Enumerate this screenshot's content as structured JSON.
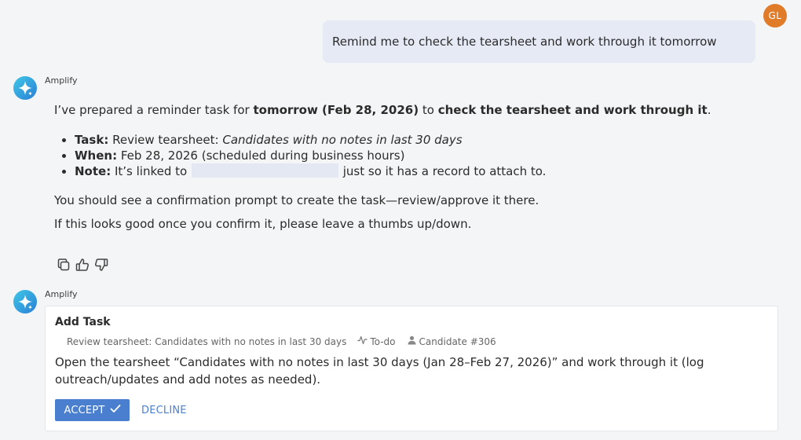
{
  "user": {
    "initials": "GL",
    "message": "Remind me to check the tearsheet and work through it tomorrow"
  },
  "assistant": {
    "name": "Amplify",
    "intro_prefix": "I’ve prepared a reminder task for ",
    "intro_bold1": "tomorrow (Feb 28, 2026)",
    "intro_mid": " to ",
    "intro_bold2": "check the tearsheet and work through it",
    "intro_suffix": ".",
    "bullets": {
      "task_label": "Task:",
      "task_text": " Review tearsheet: ",
      "task_italic": "Candidates with no notes in last 30 days",
      "when_label": "When:",
      "when_text": " Feb 28, 2026 (scheduled during business hours)",
      "note_label": "Note:",
      "note_text_before": " It’s linked to ",
      "note_text_after": " just so it has a record to attach to."
    },
    "para1": "You should see a confirmation prompt to create the task—review/approve it there.",
    "para2": "If this looks good once you confirm it, please leave a thumbs up/down."
  },
  "task_card": {
    "title": "Add Task",
    "meta_subject": "Review tearsheet: Candidates with no notes in last 30 days",
    "meta_type": "To-do",
    "meta_record": "Candidate #306",
    "description": "Open the tearsheet “Candidates with no notes in last 30 days (Jan 28–Feb 27, 2026)” and work through it (log outreach/updates and add notes as needed).",
    "accept_label": "ACCEPT",
    "decline_label": "DECLINE"
  },
  "colors": {
    "user_avatar": "#e07b2a",
    "user_bubble": "#e6eaf5",
    "accent": "#4a7fcf",
    "background": "#f4f5f7"
  }
}
